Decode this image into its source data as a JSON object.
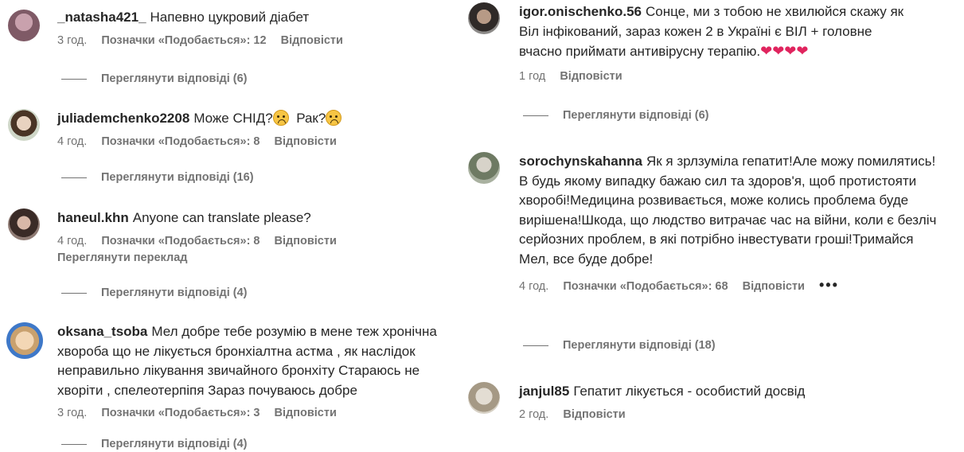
{
  "left_comments": [
    {
      "username": "_natasha421_",
      "text": "Напевно цукровий діабет",
      "time": "3 год.",
      "likes": "Позначки «Подобається»: 12",
      "reply": "Відповісти",
      "replies": "Переглянути відповіді (6)"
    },
    {
      "username": "juliademchenko2208",
      "text": "Може СНІД?",
      "text2": "Рак?",
      "time": "4 год.",
      "likes": "Позначки «Подобається»: 8",
      "reply": "Відповісти",
      "replies": "Переглянути відповіді (16)"
    },
    {
      "username": "haneul.khn",
      "text": "Anyone can translate please?",
      "time": "4 год.",
      "likes": "Позначки «Подобається»: 8",
      "reply": "Відповісти",
      "translate": "Переглянути переклад",
      "replies": "Переглянути відповіді (4)"
    },
    {
      "username": "oksana_tsoba",
      "text": "Мел добре тебе розумію в мене теж хронічна хвороба що не лікується бронхіалтна астма , як наслідок неправильно лікування звичайного бронхіту Стараюсь не хворіти , спелеотерпіпя Зараз почуваюсь добре",
      "time": "3 год.",
      "likes": "Позначки «Подобається»: 3",
      "reply": "Відповісти",
      "replies": "Переглянути відповіді (4)"
    }
  ],
  "right_comments": [
    {
      "username": "igor.onischenko.56",
      "text": "Сонце, ми з тобою не хвилюйся скажу як Віл інфікований, зараз кожен 2 в Україні є ВІЛ + головне вчасно приймати антивірусну терапію.",
      "hearts": "❤❤❤❤",
      "time": "1 год",
      "reply": "Відповісти",
      "replies": "Переглянути відповіді (6)"
    },
    {
      "username": "sorochynskahanna",
      "text": "Як я зрлзуміла гепатит!Але можу помилятись!В будь якому випадку бажаю сил та здоров'я, щоб протистояти хворобі!Медицина розвивається, може колись проблема буде вирішена!Шкода, що людство витрачає час на війни, коли є безліч серйозних проблем, в які потрібно інвестувати гроші!Тримайся Мел, все буде добре!",
      "time": "4 год.",
      "likes": "Позначки «Подобається»: 68",
      "reply": "Відповісти",
      "more": "•••",
      "replies": "Переглянути відповіді (18)"
    },
    {
      "username": "janjul85",
      "text": "Гепатит лікується - особистий досвід",
      "time": "2 год.",
      "reply": "Відповісти"
    }
  ]
}
